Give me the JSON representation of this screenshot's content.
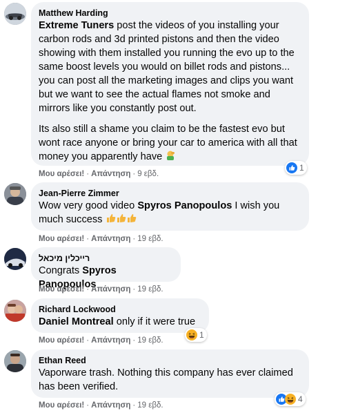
{
  "comments": [
    {
      "author": "Matthew Harding",
      "mention": "Extreme Tuners",
      "text1": " post the videos of you installing your carbon rods and 3d printed pistons and then the video showing with them installed you running the evo up to the same boost levels you would on billet rods and pistons... you can post all the marketing images and clips you want but we want to see the actual flames not smoke and mirrors like you constantly post out.",
      "text2": "Its also still a shame you claim to be the fastest evo but wont race anyone or bring your car to america with all that money you apparently have",
      "like_label": "Μου αρέσει!",
      "reply_label": "Απάντηση",
      "time": "9 εβδ.",
      "reaction_count": "1"
    },
    {
      "author": "Jean-Pierre Zimmer",
      "text_before": "Wow very good video ",
      "mention": "Spyros Panopoulos",
      "text_after": " I wish you much success",
      "like_label": "Μου αρέσει!",
      "reply_label": "Απάντηση",
      "time": "19 εβδ."
    },
    {
      "author": "רייכלין מיכאל",
      "text_before": "Congrats ",
      "mention": "Spyros Panopoulos",
      "like_label": "Μου αρέσει!",
      "reply_label": "Απάντηση",
      "time": "19 εβδ."
    },
    {
      "author": "Richard Lockwood",
      "mention": "Daniel Montreal",
      "text_after": " only if it were true",
      "like_label": "Μου αρέσει!",
      "reply_label": "Απάντηση",
      "time": "19 εβδ.",
      "reaction_count": "1"
    },
    {
      "author": "Ethan Reed",
      "text": "Vaporware trash. Nothing this company has ever claimed has been verified.",
      "like_label": "Μου αρέσει!",
      "reply_label": "Απάντηση",
      "time": "19 εβδ.",
      "reaction_count": "4"
    }
  ],
  "icons": {
    "like": "like-reaction-icon",
    "haha": "haha-reaction-icon",
    "thumbs_up": "thumbs-up-emoji",
    "facepalm": "facepalm-emoji"
  },
  "colors": {
    "bubble": "#f0f2f5",
    "like_blue": "#1877f2",
    "haha_yellow": "#f7b125",
    "muted": "#65676b"
  }
}
